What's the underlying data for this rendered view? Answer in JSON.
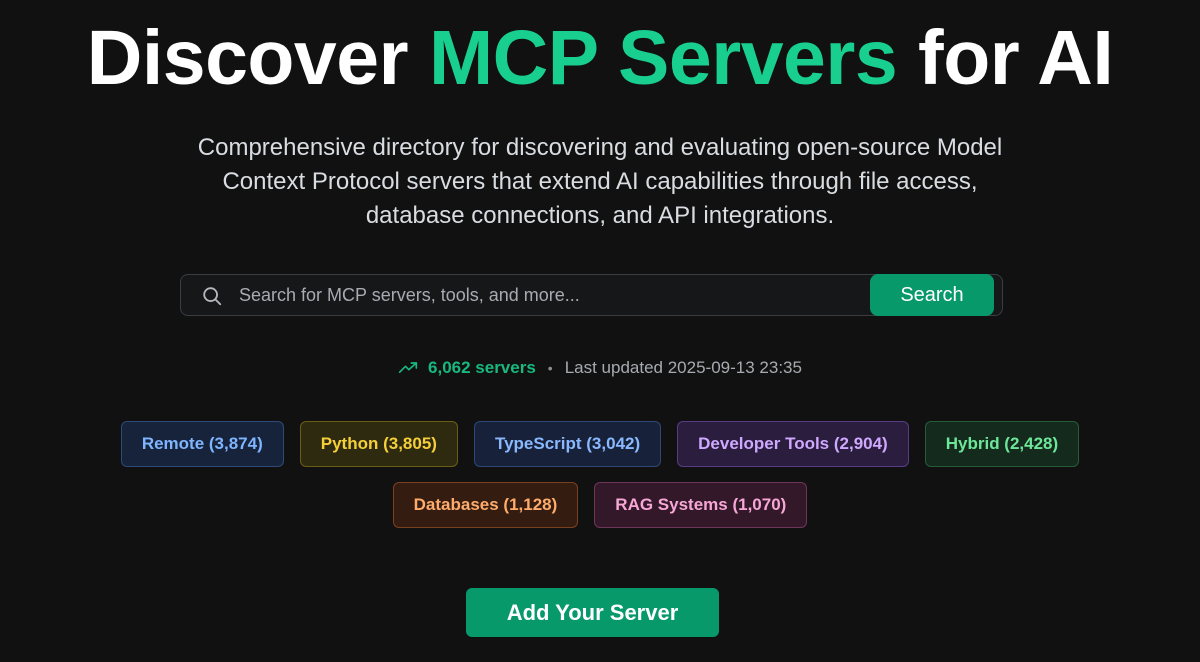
{
  "hero": {
    "title_prefix": "Discover ",
    "title_accent": "MCP Servers",
    "title_suffix": " for AI",
    "subtitle": "Comprehensive directory for discovering and evaluating open-source Model Context Protocol servers that extend AI capabilities through file access, database connections, and API integrations."
  },
  "search": {
    "placeholder": "Search for MCP servers, tools, and more...",
    "value": "",
    "button_label": "Search"
  },
  "stats": {
    "server_count": "6,062 servers",
    "separator": "•",
    "last_updated": "Last updated 2025-09-13 23:35"
  },
  "tags": [
    {
      "label": "Remote (3,874)",
      "color": "#7fb5ff",
      "bg": "#16233a",
      "border": "#2d4a78"
    },
    {
      "label": "Python (3,805)",
      "color": "#f5cf3a",
      "bg": "#2e2a10",
      "border": "#6b5d16"
    },
    {
      "label": "TypeScript (3,042)",
      "color": "#8ab8ff",
      "bg": "#17223a",
      "border": "#2e4775"
    },
    {
      "label": "Developer Tools (2,904)",
      "color": "#cfa8ff",
      "bg": "#2a1d3d",
      "border": "#5a3b85"
    },
    {
      "label": "Hybrid (2,428)",
      "color": "#6ee69a",
      "bg": "#132a1c",
      "border": "#275c3a"
    },
    {
      "label": "Databases (1,128)",
      "color": "#ffab6b",
      "bg": "#341d10",
      "border": "#7a4020"
    },
    {
      "label": "RAG Systems (1,070)",
      "color": "#f7a6d6",
      "bg": "#331829",
      "border": "#6e3659"
    }
  ],
  "cta": {
    "add_server_label": "Add Your Server"
  },
  "colors": {
    "background": "#111111",
    "accent": "#19cf8f",
    "button": "#07996a"
  }
}
